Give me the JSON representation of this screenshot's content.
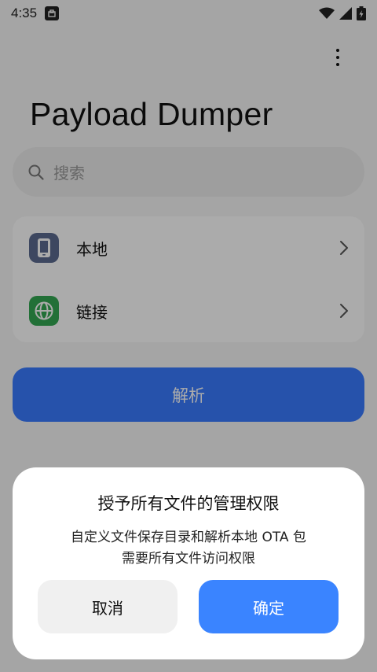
{
  "status_bar": {
    "time": "4:35"
  },
  "app": {
    "title": "Payload Dumper"
  },
  "search": {
    "placeholder": "搜索"
  },
  "sources": {
    "items": [
      {
        "label": "本地",
        "icon": "phone-icon",
        "icon_color": "#5b6b8f"
      },
      {
        "label": "链接",
        "icon": "globe-icon",
        "icon_color": "#34a853"
      }
    ]
  },
  "actions": {
    "parse_label": "解析",
    "parse_color": "#3a7bff"
  },
  "dialog": {
    "title": "授予所有文件的管理权限",
    "message_line1": "自定义文件保存目录和解析本地 OTA 包",
    "message_line2": "需要所有文件访问权限",
    "cancel_label": "取消",
    "confirm_label": "确定",
    "confirm_color": "#3a84ff"
  }
}
